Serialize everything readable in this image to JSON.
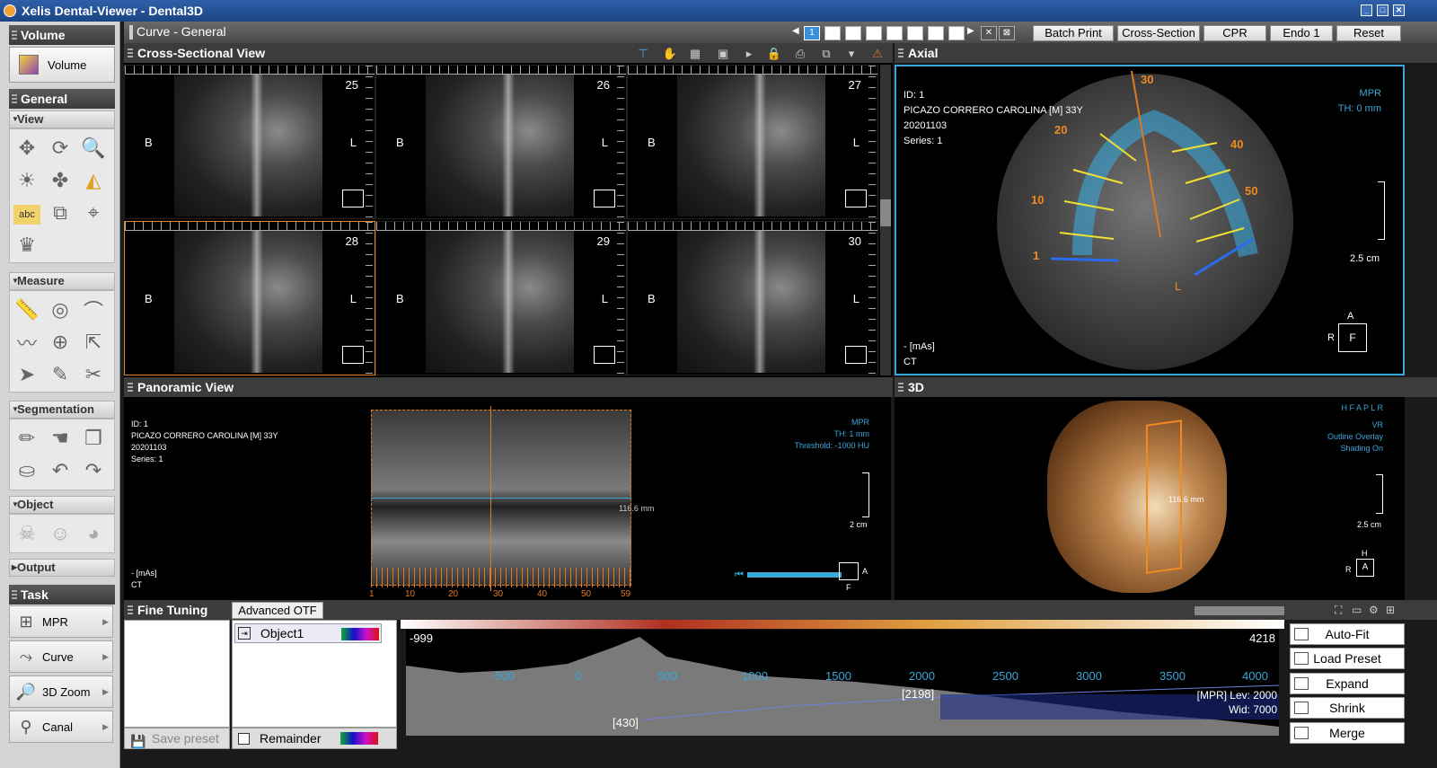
{
  "window": {
    "title": "Xelis Dental-Viewer - Dental3D"
  },
  "sidebar": {
    "volume_header": "Volume",
    "volume_button": "Volume",
    "general_header": "General",
    "view_header": "View",
    "measure_header": "Measure",
    "segmentation_header": "Segmentation",
    "object_header": "Object",
    "output_header": "Output",
    "task_header": "Task",
    "tasks": [
      {
        "label": "MPR"
      },
      {
        "label": "Curve"
      },
      {
        "label": "3D Zoom"
      },
      {
        "label": "Canal"
      }
    ],
    "abc_label": "abc"
  },
  "toolbar": {
    "curve_title": "Curve - General",
    "page_current": "1",
    "buttons": {
      "batch_print": "Batch Print",
      "cross_section": "Cross-Section",
      "cpr": "CPR",
      "endo": "Endo 1",
      "reset": "Reset"
    }
  },
  "cross_section": {
    "title": "Cross-Sectional View",
    "cells": [
      {
        "num": "25"
      },
      {
        "num": "26"
      },
      {
        "num": "27"
      },
      {
        "num": "28"
      },
      {
        "num": "29"
      },
      {
        "num": "30"
      }
    ],
    "label_b": "B",
    "label_l": "L"
  },
  "axial": {
    "title": "Axial",
    "id": "ID: 1",
    "patient": "PICAZO CORRERO CAROLINA [M] 33Y",
    "date": "20201103",
    "series": "Series: 1",
    "mode": "MPR",
    "th": "TH: 0 mm",
    "scale": "2.5 cm",
    "mas": "- [mAs]",
    "modality": "CT",
    "markers": {
      "m30": "30",
      "m20": "20",
      "m40": "40",
      "m10": "10",
      "m50": "50",
      "m1": "1",
      "l": "L"
    },
    "orient": {
      "a": "A",
      "r": "R",
      "f": "F"
    }
  },
  "panoramic": {
    "title": "Panoramic View",
    "id": "ID: 1",
    "patient": "PICAZO CORRERO CAROLINA [M] 33Y",
    "date": "20201103",
    "series": "Series: 1",
    "mode": "MPR",
    "th": "TH: 1 mm",
    "threshold": "Threshold: -1000 HU",
    "scale": "2 cm",
    "mas": "- [mAs]",
    "modality": "CT",
    "measure": "116.6 mm",
    "axis_labels": [
      "1",
      "10",
      "20",
      "30",
      "40",
      "50",
      "59"
    ],
    "orient": {
      "a": "A",
      "f": "F"
    }
  },
  "view3d": {
    "title": "3D",
    "orient_string": "H F A P L R",
    "mode": "VR",
    "outline": "Outline Overlay",
    "shading": "Shading On",
    "scale": "2.5 cm",
    "measure": "116.6 mm",
    "orient": {
      "h": "H",
      "r": "R",
      "a": "A"
    }
  },
  "fine_tuning": {
    "title": "Fine Tuning",
    "tab_advanced": "Advanced OTF",
    "object1": "Object1",
    "remainder": "Remainder",
    "save_preset": "Save preset",
    "hist_min": "-999",
    "hist_max": "4218",
    "ticks": [
      "-500",
      "0",
      "500",
      "1000",
      "1500",
      "2000",
      "2500",
      "3000",
      "3500",
      "4000"
    ],
    "marker1": "[2198]",
    "marker2": "[430]",
    "lev": "[MPR] Lev:  2000",
    "wid": "Wid:  7000",
    "buttons": {
      "auto_fit": "Auto-Fit",
      "load_preset": "Load Preset",
      "expand": "Expand",
      "shrink": "Shrink",
      "merge": "Merge"
    }
  }
}
